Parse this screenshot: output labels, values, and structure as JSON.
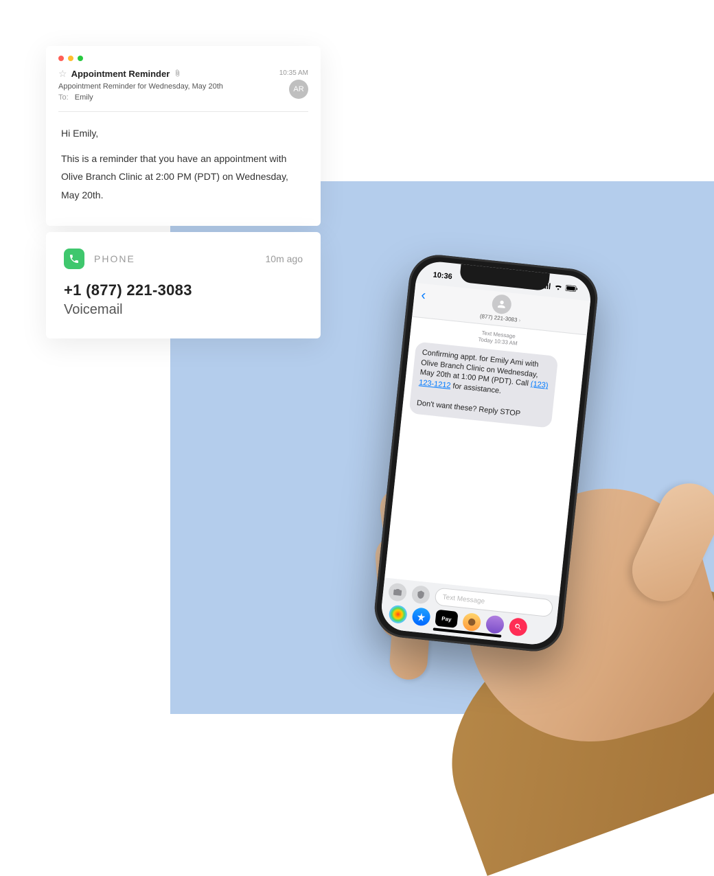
{
  "email": {
    "title": "Appointment Reminder",
    "time": "10:35 AM",
    "avatar_initials": "AR",
    "subject": "Appointment Reminder for Wednesday, May 20th",
    "to_label": "To:",
    "to_name": "Emily",
    "greeting": "Hi Emily,",
    "body": "This is a reminder that you have an appointment with Olive Branch Clinic at 2:00 PM (PDT) on Wednesday, May 20th."
  },
  "notification": {
    "app_label": "PHONE",
    "time": "10m ago",
    "number": "+1 (877) 221-3083",
    "subtitle": "Voicemail"
  },
  "phone": {
    "status": {
      "time": "10:36",
      "signal_icon": "signal",
      "wifi_icon": "wifi",
      "battery_icon": "battery"
    },
    "header": {
      "contact_number": "(877) 221-3083",
      "chevron": "›"
    },
    "thread": {
      "meta_label": "Text Message",
      "meta_time": "Today 10:33 AM",
      "bubble_text_before_link": "Confirming appt. for Emily Ami with Olive Branch Clinic on Wednesday, May 20th at 1:00 PM (PDT). Call ",
      "bubble_link": "(123) 123-1212",
      "bubble_text_after_link": " for assistance.",
      "bubble_line2": "Don't want these? Reply STOP"
    },
    "input": {
      "placeholder": "Text Message"
    },
    "apps": {
      "apple_pay": "Pay"
    }
  }
}
